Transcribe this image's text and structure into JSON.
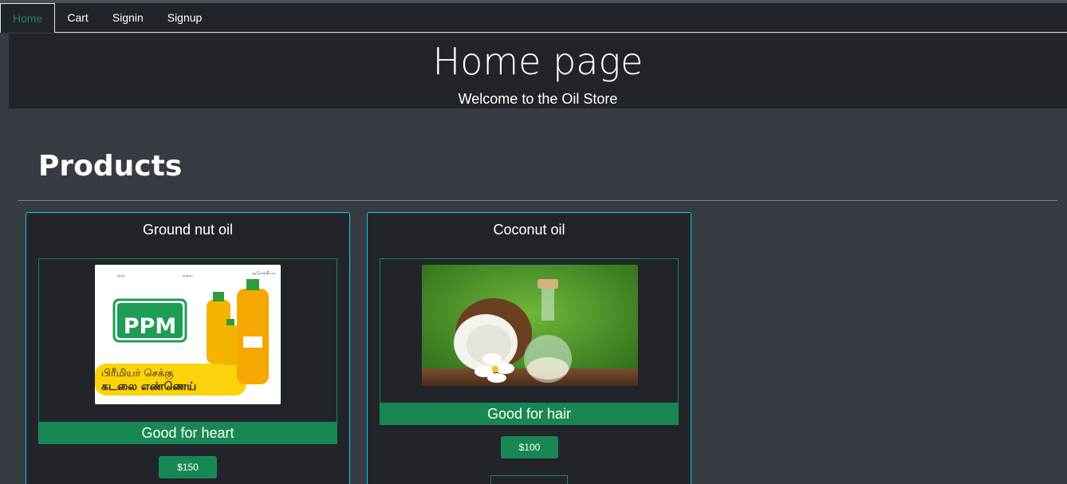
{
  "nav": {
    "items": [
      {
        "label": "Home",
        "active": true
      },
      {
        "label": "Cart"
      },
      {
        "label": "Signin"
      },
      {
        "label": "Signup"
      }
    ]
  },
  "hero": {
    "title": "Home page",
    "subtitle": "Welcome to the Oil Store"
  },
  "section": {
    "title": "Products"
  },
  "products": [
    {
      "name": "Ground nut oil",
      "description": "Good for heart",
      "price": "$150",
      "image": {
        "brand": "PPM",
        "tamil_line1": "பிரீமியர் செக்கு",
        "tamil_line2": "கடலை எண்ணெய்"
      }
    },
    {
      "name": "Coconut oil",
      "description": "Good for hair",
      "price": "$100"
    }
  ],
  "colors": {
    "accent": "#198754",
    "card_border": "#0dcaf0",
    "dark": "#212529",
    "page_bg": "#373b42"
  }
}
